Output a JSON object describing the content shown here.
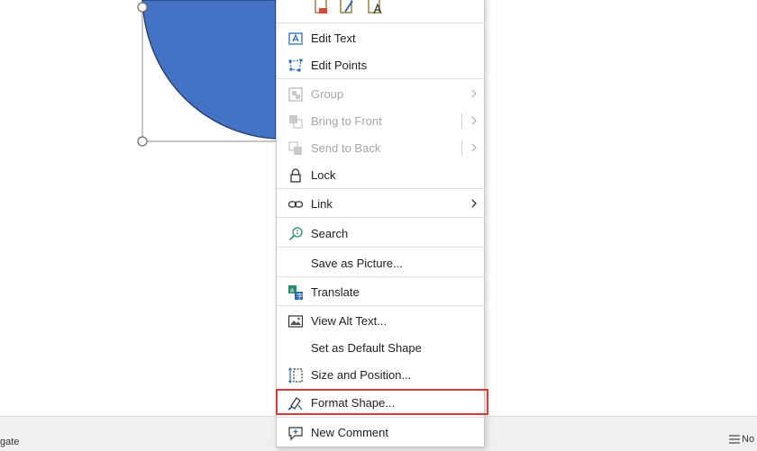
{
  "status_bar": {
    "left_text": "gate",
    "right_text": "No"
  },
  "context_menu": {
    "items": {
      "edit_text": "Edit Text",
      "edit_points": "Edit Points",
      "group": "Group",
      "bring_to_front": "Bring to Front",
      "send_to_back": "Send to Back",
      "lock": "Lock",
      "link": "Link",
      "search": "Search",
      "save_as_picture": "Save as Picture...",
      "translate": "Translate",
      "view_alt_text": "View Alt Text...",
      "set_default_shape": "Set as Default Shape",
      "size_and_position": "Size and Position...",
      "format_shape": "Format Shape...",
      "new_comment": "New Comment"
    },
    "highlighted_item": "Format Shape..."
  },
  "colors": {
    "shape_fill": "#4472c4",
    "highlight_border": "#d93a3a",
    "accent_icon": "#2b6cb0"
  }
}
